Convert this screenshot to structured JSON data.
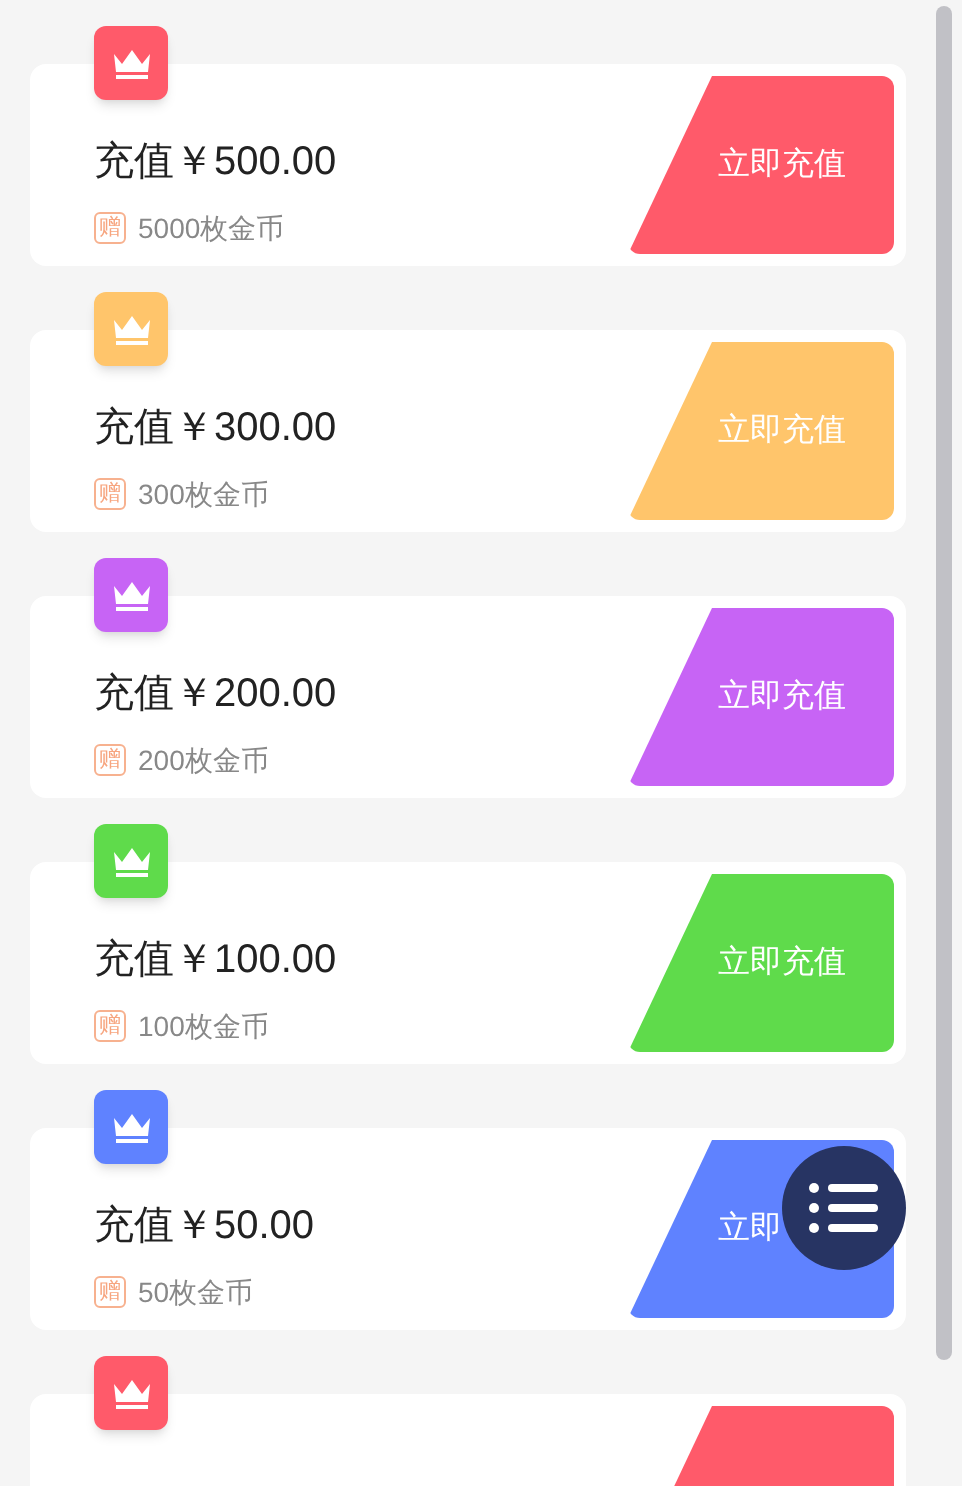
{
  "plans": [
    {
      "color": "#ff5a6a",
      "title": "充值￥500.00",
      "gift_tag": "赠",
      "bonus": "5000枚金币",
      "button": "立即充值"
    },
    {
      "color": "#ffc56b",
      "title": "充值￥300.00",
      "gift_tag": "赠",
      "bonus": "300枚金币",
      "button": "立即充值"
    },
    {
      "color": "#c764f5",
      "title": "充值￥200.00",
      "gift_tag": "赠",
      "bonus": "200枚金币",
      "button": "立即充值"
    },
    {
      "color": "#5fdb4b",
      "title": "充值￥100.00",
      "gift_tag": "赠",
      "bonus": "100枚金币",
      "button": "立即充值"
    },
    {
      "color": "#5f82ff",
      "title": "充值￥50.00",
      "gift_tag": "赠",
      "bonus": "50枚金币",
      "button": "立即"
    },
    {
      "color": "#ff5a6a"
    }
  ]
}
